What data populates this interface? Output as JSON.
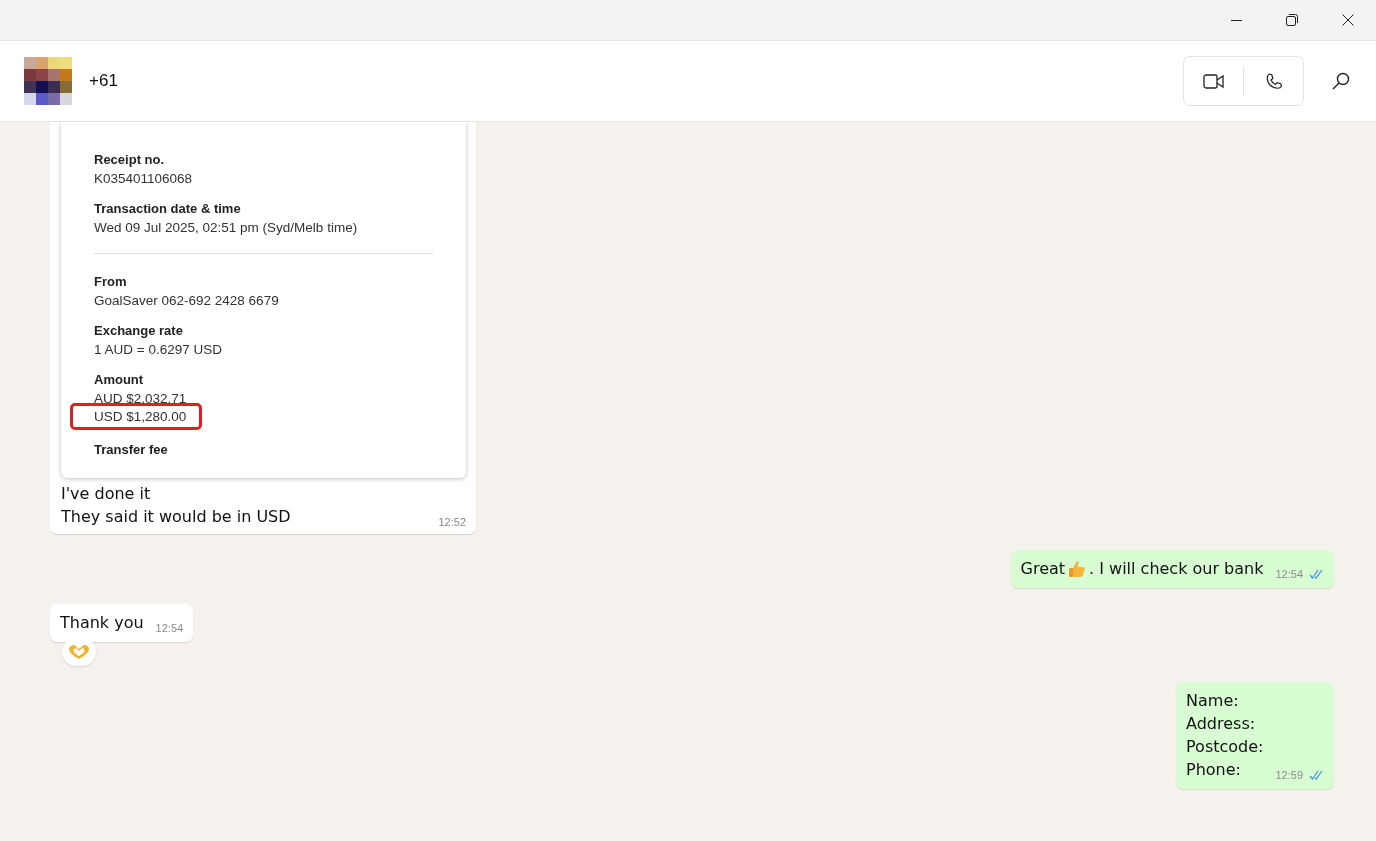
{
  "header": {
    "contact": "+61",
    "actions": [
      {
        "kind": "video"
      },
      {
        "kind": "call"
      }
    ]
  },
  "messages": [
    {
      "kind": "incoming_receipt",
      "receipt": {
        "fields": [
          {
            "label": "Receipt no.",
            "values": [
              {
                "text": "K035401106068",
                "highlighted": false
              }
            ]
          },
          {
            "label": "Transaction date & time",
            "values": [
              {
                "text": "Wed 09 Jul 2025, 02:51 pm (Syd/Melb time)",
                "highlighted": false
              }
            ]
          },
          {
            "label": "From",
            "values": [
              {
                "text": "GoalSaver 062-692 2428 6679",
                "highlighted": false
              }
            ]
          },
          {
            "label": "Exchange rate",
            "values": [
              {
                "text": "1 AUD = 0.6297 USD",
                "highlighted": false
              }
            ]
          },
          {
            "label": "Amount",
            "values": [
              {
                "text": "AUD $2,032.71",
                "highlighted": false
              },
              {
                "text": "USD $1,280.00",
                "highlighted": true
              }
            ]
          },
          {
            "label": "Transfer fee"
          }
        ]
      },
      "lines": [
        "I've done it",
        "They said it would be in USD"
      ],
      "time": "12:52"
    },
    {
      "kind": "outgoing_thumbs",
      "parts": [
        "Great",
        ". I will check our bank"
      ],
      "time": "12:54",
      "read": true
    },
    {
      "kind": "incoming_reacted",
      "lines": [
        "Thank you"
      ],
      "time": "12:54"
    },
    {
      "kind": "outgoing",
      "lines": [
        "Name:",
        "Address:",
        "Postcode:",
        "Phone:"
      ],
      "time": "12:59",
      "read": true
    }
  ]
}
